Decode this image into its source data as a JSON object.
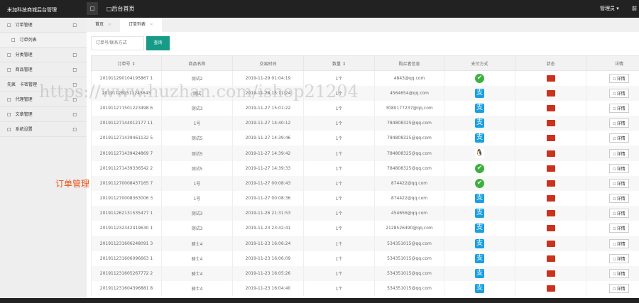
{
  "header": {
    "brand": "米加科技商城后台管理",
    "menu_icon": "□",
    "home": "□后台首页",
    "admin": "管理员 ▾",
    "front": "前"
  },
  "sidebar": [
    {
      "label": "订单管理",
      "icon": "□",
      "arrow": "□"
    },
    {
      "label": "订单列表",
      "icon": "□",
      "sub": true
    },
    {
      "label": "分类管理",
      "icon": "□",
      "arrow": "□"
    },
    {
      "label": "商品管理",
      "icon": "□",
      "arrow": "□"
    },
    {
      "label": "卡密管理",
      "icon": "先疯",
      "arrow": "□"
    },
    {
      "label": "代理管理",
      "icon": "□",
      "arrow": "□"
    },
    {
      "label": "文章管理",
      "icon": "□",
      "arrow": "□"
    },
    {
      "label": "系统设置",
      "icon": "□",
      "arrow": "□"
    }
  ],
  "tabs": [
    {
      "label": "首页",
      "close": "∞"
    },
    {
      "label": "订单列表",
      "close": "∞"
    }
  ],
  "search": {
    "placeholder": "订单号/联系方式",
    "button": "查询"
  },
  "floating_label": "订单管理",
  "watermark": "https://www.huzhan.com/ishop21204",
  "table": {
    "headers": [
      "订单号 ⇕",
      "商品名称",
      "交易时间",
      "数量 ⇕",
      "购买者信息",
      "支付方式",
      "状态",
      "详情"
    ],
    "detail_label": "□ 详情",
    "rows": [
      [
        "201911290104195867 1",
        "测试2",
        "2019-11-29 01:04:19",
        "1个",
        "4843@qq.com",
        "wechat"
      ],
      [
        "201911281511245643",
        "测试",
        "2019-11-28 15:11:24",
        "1个",
        "4564654@qq.com",
        "alipay"
      ],
      [
        "201911271501223498 6",
        "测试3",
        "2019-11-27 15:01:22",
        "1个",
        "3080177237@qq.com",
        "alipay"
      ],
      [
        "20191127144012177 11",
        "1号",
        "2019-11-27 14:40:12",
        "1个",
        "784808325@qq.com",
        "alipay"
      ],
      [
        "201911271439461132 5",
        "测试5",
        "2019-11-27 14:39:46",
        "1个",
        "784808325@qq.com",
        "alipay"
      ],
      [
        "201911271439424869 7",
        "测试5",
        "2019-11-27 14:39:42",
        "1个",
        "784808325@qq.com",
        "qq"
      ],
      [
        "201911271439336542 2",
        "测试5",
        "2019-11-27 14:39:33",
        "1个",
        "784808325@qq.com",
        "wechat"
      ],
      [
        "201911270008437165 7",
        "1号",
        "2019-11-27 00:08:43",
        "1个",
        "874422@qq.com",
        "wechat"
      ],
      [
        "201911270008363006 3",
        "1号",
        "2019-11-27 00:08:36",
        "1个",
        "874422@qq.com",
        "alipay"
      ],
      [
        "201911262131535477 1",
        "测试3",
        "2019-11-26 21:31:53",
        "1个",
        "454656@qq.com",
        "alipay"
      ],
      [
        "201911232342419630 1",
        "测试3",
        "2019-11-23 23:42:41",
        "1个",
        "2128526490@qq.com",
        "alipay"
      ],
      [
        "201911231606248091 3",
        "骑士4",
        "2019-11-23 16:06:24",
        "1个",
        "534351015@qq.com",
        "alipay"
      ],
      [
        "201911231606096663 1",
        "骑士4",
        "2019-11-23 16:06:09",
        "1个",
        "534351015@qq.com",
        "alipay"
      ],
      [
        "201911231605267772 2",
        "骑士4",
        "2019-11-23 16:05:26",
        "1个",
        "534351015@qq.com",
        "alipay"
      ],
      [
        "201911231604396881 8",
        "骑士4",
        "2019-11-23 16:04:40",
        "1个",
        "534351015@qq.com",
        "alipay"
      ]
    ]
  }
}
